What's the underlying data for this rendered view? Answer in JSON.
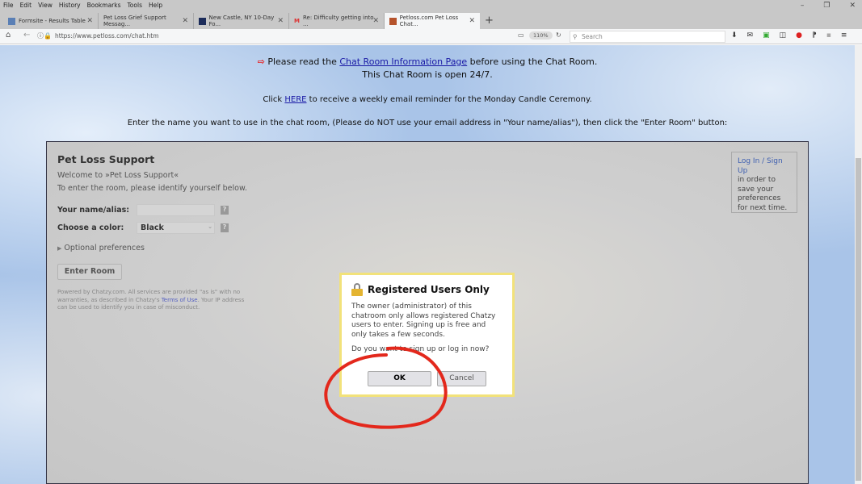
{
  "browser": {
    "menu": [
      "File",
      "Edit",
      "View",
      "History",
      "Bookmarks",
      "Tools",
      "Help"
    ],
    "tabs": [
      {
        "label": "Formsite - Results Table",
        "active": false
      },
      {
        "label": "Pet Loss Grief Support Messag...",
        "active": false
      },
      {
        "label": "New Castle, NY 10-Day Fo...",
        "active": false
      },
      {
        "label": "Re: Difficulty getting into ...",
        "active": false
      },
      {
        "label": "Petloss.com Pet Loss Chat...",
        "active": true
      }
    ],
    "url": "https://www.petloss.com/chat.htm",
    "zoom": "110%",
    "search_placeholder": "Search"
  },
  "intro": {
    "line1_pre": "Please read the ",
    "line1_link": "Chat Room Information Page",
    "line1_post": " before using the Chat Room.",
    "line2": "This Chat Room is open 24/7.",
    "line3_pre": "Click ",
    "line3_link": "HERE",
    "line3_post": " to receive a weekly email reminder for the Monday Candle Ceremony.",
    "line4": "Enter the name you want to use in the chat room, (Please do NOT use your email address in \"Your name/alias\"), then click the \"Enter Room\" button:"
  },
  "chat": {
    "title": "Pet Loss Support",
    "welcome": "Welcome to »Pet Loss Support«",
    "instruction": "To enter the room, please identify yourself below.",
    "name_label": "Your name/alias:",
    "name_value": "",
    "color_label": "Choose a color:",
    "color_value": "Black",
    "help": "?",
    "optional": "Optional preferences",
    "enter_button": "Enter Room",
    "powered_pre": "Powered by Chatzy.com. All services are provided \"as is\" with no warranties, as described in Chatzy's ",
    "powered_link": "Terms of Use",
    "powered_post": ". Your IP address can be used to identify you in case of misconduct.",
    "login_link": "Log In / Sign Up",
    "login_text": "in order to save your preferences for next time."
  },
  "modal": {
    "title": "Registered Users Only",
    "body": "The owner (administrator) of this chatroom only allows registered Chatzy users to enter. Signing up is free and only takes a few seconds.",
    "question": "Do you want to sign up or log in now?",
    "ok": "OK",
    "cancel": "Cancel"
  },
  "colors": {
    "page_bg": "#a9c4e8",
    "annotation": "#e3281c",
    "modal_border": "#f2e27a"
  }
}
